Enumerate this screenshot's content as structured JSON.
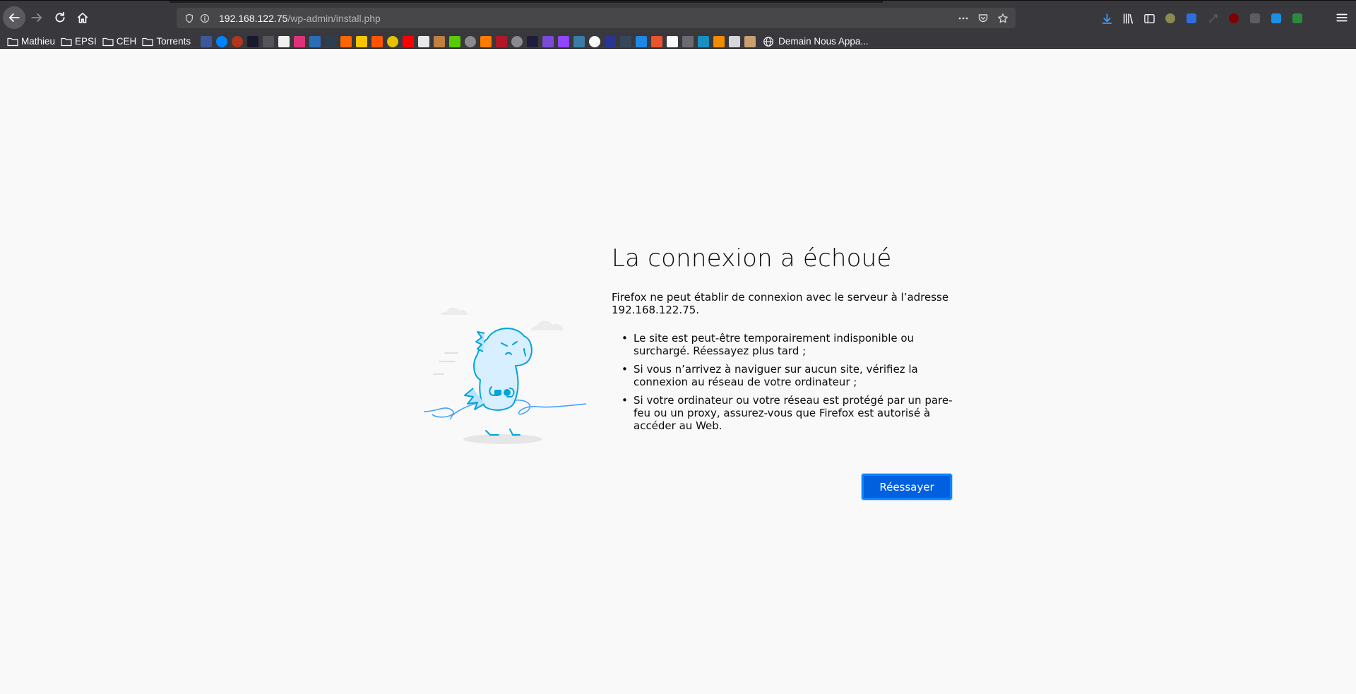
{
  "browser": {
    "url_host": "192.168.122.75",
    "url_path": "/wp-admin/install.php",
    "colors": {
      "toolbar": "#38383d",
      "urlbar": "#474749",
      "accent": "#0060df"
    }
  },
  "bookmarks": {
    "folders": [
      "Mathieu",
      "EPSI",
      "CEH",
      "Torrents"
    ],
    "last_item": "Demain Nous Appa..."
  },
  "error": {
    "title": "La connexion a échoué",
    "description": "Firefox ne peut établir de connexion avec le serveur à l’adresse 192.168.122.75.",
    "items": [
      "Le site est peut-être temporairement indisponible ou surchargé. Réessayez plus tard ;",
      "Si vous n’arrivez à naviguer sur aucun site, vérifiez la connexion au réseau de votre ordinateur ;",
      "Si votre ordinateur ou votre réseau est protégé par un pare-feu ou un proxy, assurez-vous que Firefox est autorisé à accéder au Web."
    ],
    "retry_label": "Réessayer"
  }
}
